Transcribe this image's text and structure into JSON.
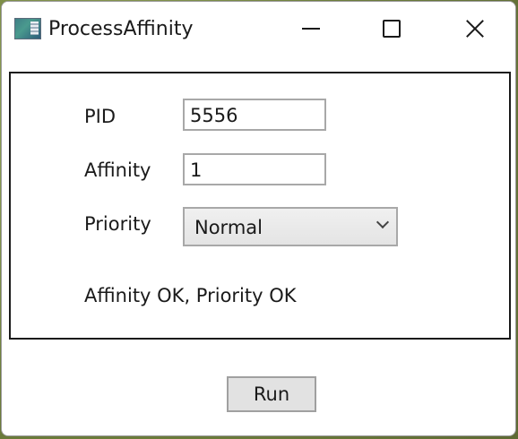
{
  "window": {
    "title": "ProcessAffinity",
    "icon": "app-window-icon",
    "controls": {
      "minimize": "minimize-icon",
      "maximize": "maximize-icon",
      "close": "close-icon"
    }
  },
  "form": {
    "pid_label": "PID",
    "pid_value": "5556",
    "affinity_label": "Affinity",
    "affinity_value": "1",
    "priority_label": "Priority",
    "priority_selected": "Normal",
    "status_text": "Affinity OK, Priority OK"
  },
  "actions": {
    "run_label": "Run"
  }
}
